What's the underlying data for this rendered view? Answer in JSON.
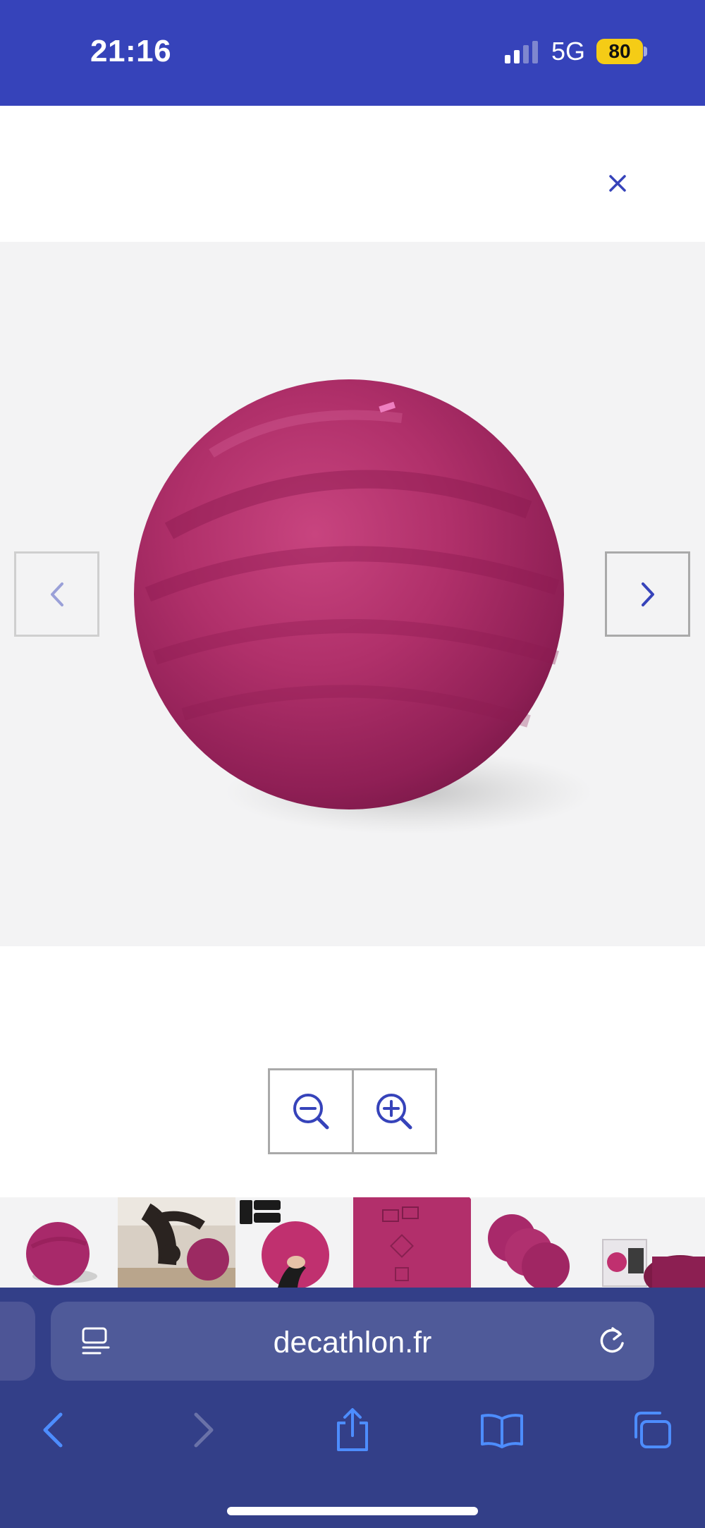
{
  "status_bar": {
    "time": "21:16",
    "network": "5G",
    "battery": "80",
    "colors": {
      "background": "#3643ba",
      "battery": "#f5cc16"
    }
  },
  "header": {
    "close_icon": "close-icon"
  },
  "viewer": {
    "product_image": "pink-fitness-ball",
    "prev_icon": "chevron-left-icon",
    "next_icon": "chevron-right-icon"
  },
  "zoom": {
    "zoom_out_icon": "zoom-out-icon",
    "zoom_in_icon": "zoom-in-icon"
  },
  "thumbnails": [
    {
      "subject": "fitness-ball-front",
      "active": true
    },
    {
      "subject": "woman-stretching-with-ball",
      "active": false
    },
    {
      "subject": "hand-on-ball-app-badges",
      "active": false
    },
    {
      "subject": "ball-closeup-markings",
      "active": false
    },
    {
      "subject": "three-balls",
      "active": false
    },
    {
      "subject": "ball-with-box",
      "active": false
    }
  ],
  "browser": {
    "url": "decathlon.fr",
    "toolbar": [
      "back-icon",
      "forward-icon",
      "share-icon",
      "bookmarks-icon",
      "tabs-icon"
    ],
    "colors": {
      "background": "#333f88",
      "url_bar": "#4f5a99",
      "accent": "#4d8dff"
    }
  }
}
